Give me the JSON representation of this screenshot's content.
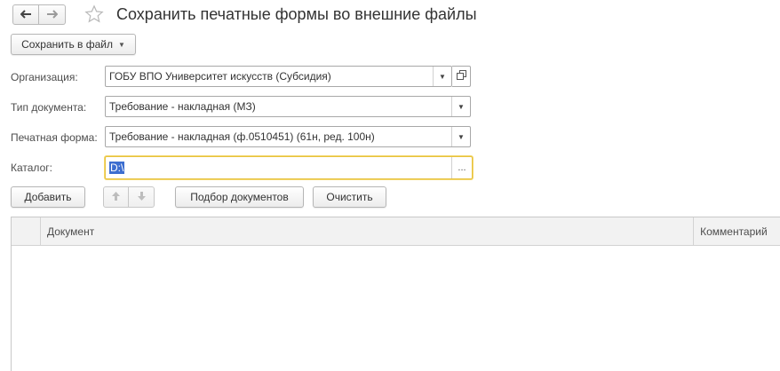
{
  "header": {
    "back_icon": "arrow-left",
    "forward_icon": "arrow-right",
    "favorite_icon": "star-outline",
    "title": "Сохранить печатные формы во внешние файлы"
  },
  "toolbar": {
    "save_to_file_label": "Сохранить в файл"
  },
  "form": {
    "organization": {
      "label": "Организация:",
      "value": "ГОБУ ВПО Университет искусств (Субсидия)"
    },
    "doc_type": {
      "label": "Тип документа:",
      "value": "Требование - накладная (МЗ)"
    },
    "print_form": {
      "label": "Печатная форма:",
      "value": "Требование - накладная (ф.0510451) (61н, ред. 100н)"
    },
    "catalog": {
      "label": "Каталог:",
      "value": "D:\\",
      "select_button": "..."
    }
  },
  "actions": {
    "add_label": "Добавить",
    "pick_docs_label": "Подбор документов",
    "clear_label": "Очистить"
  },
  "table": {
    "columns": [
      "",
      "Документ",
      "Комментарий"
    ],
    "rows": []
  },
  "colors": {
    "focus_border": "#e7c23f",
    "selection": "#3d6ed0"
  }
}
